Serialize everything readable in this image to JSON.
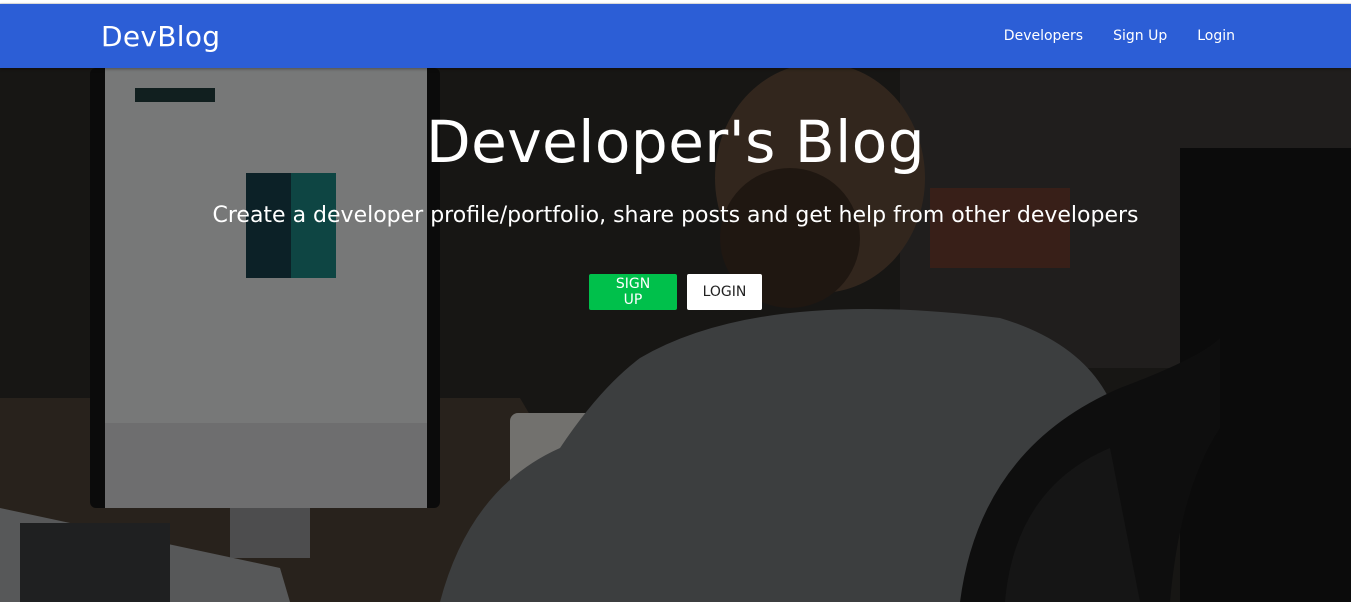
{
  "navbar": {
    "brand": "DevBlog",
    "links": [
      "Developers",
      "Sign Up",
      "Login"
    ]
  },
  "hero": {
    "title": "Developer's Blog",
    "subtitle": "Create a developer profile/portfolio, share posts and get help from other developers",
    "signup_label": "SIGN UP",
    "login_label": "LOGIN"
  },
  "colors": {
    "navbar": "#2c5ed6",
    "signup_button": "#00c04b",
    "login_button": "#ffffff"
  }
}
